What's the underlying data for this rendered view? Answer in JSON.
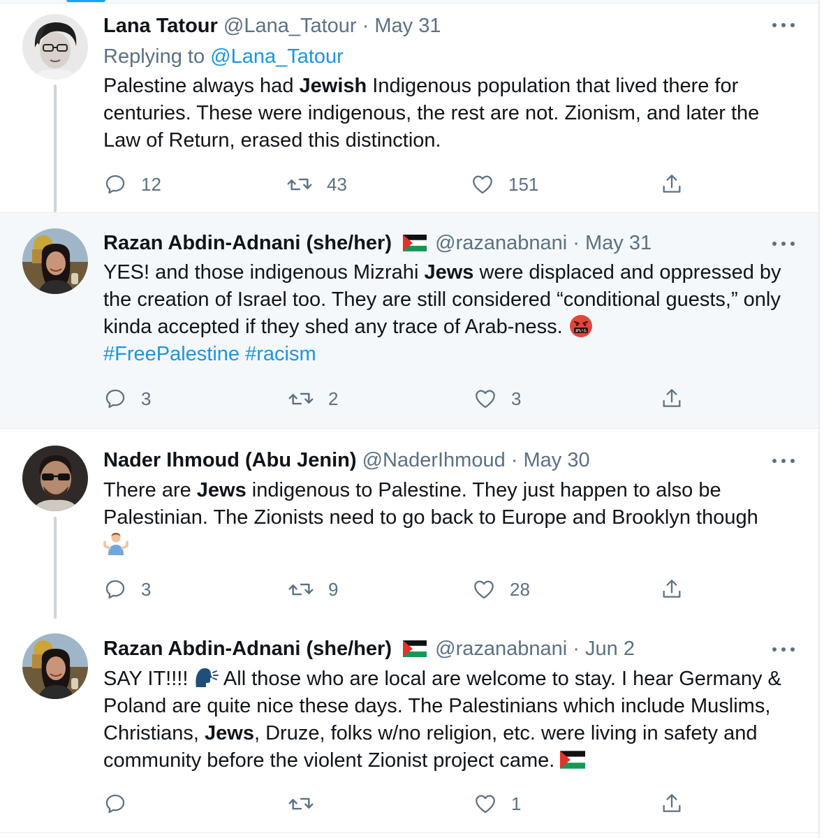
{
  "tweets": [
    {
      "name": "Lana Tatour",
      "handle": "@Lana_Tatour",
      "sep": "·",
      "date": "May 31",
      "replying_prefix": "Replying to",
      "replying_handle": "@Lana_Tatour",
      "text": {
        "p1": "Palestine always had ",
        "b1": "Jewish",
        "p2": " Indigenous population that lived there for centuries. These were indigenous, the rest are not. Zionism, and later the Law of Return, erased this distinction."
      },
      "counts": {
        "reply": "12",
        "retweet": "43",
        "like": "151"
      }
    },
    {
      "name": "Razan Abdin-Adnani (she/her)",
      "flag_icon": "palestine-flag-icon",
      "handle": "@razanabnani",
      "sep": "·",
      "date": "May 31",
      "text": {
        "p1": "YES! and those indigenous Mizrahi ",
        "b1": "Jews",
        "p2": " were displaced and oppressed by the creation of Israel too. They are still considered “conditional guests,” only kinda accepted if they shed any trace of Arab-ness. ",
        "hashtags": [
          "#FreePalestine",
          "#racism"
        ]
      },
      "emoji_icon": "cursing-face-emoji-icon",
      "counts": {
        "reply": "3",
        "retweet": "2",
        "like": "3"
      }
    },
    {
      "name": "Nader Ihmoud (Abu Jenin)",
      "handle": "@NaderIhmoud",
      "sep": "·",
      "date": "May 30",
      "text": {
        "p1": "There are ",
        "b1": "Jews",
        "p2": " indigenous to Palestine. They just happen to also be Palestinian. The Zionists need to go back to Europe and Brooklyn though"
      },
      "emoji_icon": "shrug-emoji-icon",
      "counts": {
        "reply": "3",
        "retweet": "9",
        "like": "28"
      }
    },
    {
      "name": "Razan Abdin-Adnani (she/her)",
      "flag_icon": "palestine-flag-icon",
      "handle": "@razanabnani",
      "sep": "·",
      "date": "Jun 2",
      "text": {
        "p1": "SAY IT!!!! ",
        "p2": " All those who are local are welcome to stay. I hear Germany & Poland are quite nice these days. The Palestinians which include Muslims, Christians, ",
        "b1": "Jews",
        "p3": ", Druze, folks w/no religion, etc. were living in safety and community before the violent Zionist project came. "
      },
      "emoji_icon": "speaking-head-emoji-icon",
      "counts": {
        "reply": "",
        "retweet": "",
        "like": "1"
      }
    }
  ],
  "colors": {
    "accent": "#1b95e0",
    "muted": "#5b7083",
    "highlight_bg": "#f5f8fa",
    "flag_red": "#e4312b",
    "flag_green": "#149954"
  }
}
